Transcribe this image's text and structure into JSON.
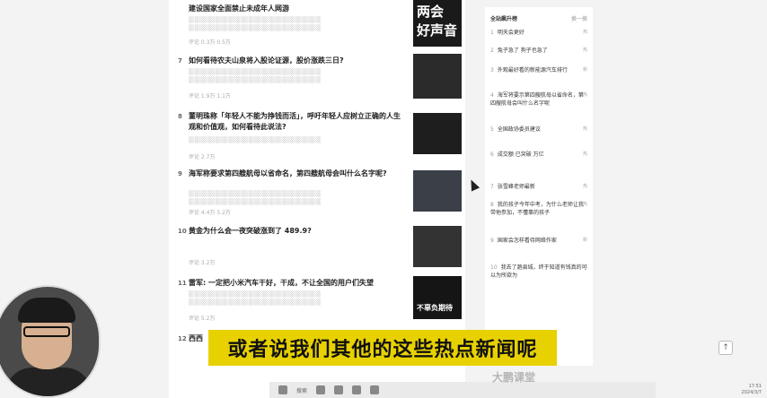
{
  "feed": {
    "items": [
      {
        "num": "",
        "title": "建设国家全面禁止未成年人网游",
        "meta": "评论 0.3万 0.5万"
      },
      {
        "num": "7",
        "title": "如何看待农夫山泉将入股论证源，股价涨跌三日?",
        "meta": "评论 1.9万 1.1万"
      },
      {
        "num": "8",
        "title": "董明珠称「年轻人不能为挣钱而活」，呼吁年轻人应树立正确的人生观和价值观，如何看待此说法?",
        "meta": "评论 2.7万"
      },
      {
        "num": "9",
        "title": "海军称要求第四艘航母以省命名，第四艘航母会叫什么名字呢?",
        "meta": "评论 4.4万 5.2万"
      },
      {
        "num": "10",
        "title": "黄金为什么会一夜突破涨到了 489.9?",
        "meta": "评论 3.2万"
      },
      {
        "num": "11",
        "title": "雷军: 一定把小米汽车干好，干成，不让全国的用户们失望",
        "meta": "评论 5.2万"
      },
      {
        "num": "12",
        "title": "西西",
        "meta": ""
      }
    ],
    "thumb1_text": "两会 好声音",
    "thumb6_text": "不辜负期待"
  },
  "sidebar": {
    "header": "全站飙升榜",
    "more": "换一换",
    "items": [
      {
        "num": "1",
        "text": "明天会更好",
        "tag": "热"
      },
      {
        "num": "2",
        "text": "兔子急了 狗子也急了",
        "tag": "热"
      },
      {
        "num": "3",
        "text": "外观最好看的新能源汽车排行",
        "tag": "新"
      },
      {
        "num": "4",
        "text": "海军将要示第四艘航母以省命名，第四艘航母会叫什么名字呢",
        "tag": "热"
      },
      {
        "num": "5",
        "text": "全国政协委员建议",
        "tag": "热"
      },
      {
        "num": "6",
        "text": "成交额 已突破 万亿",
        "tag": "热"
      },
      {
        "num": "7",
        "text": "张雪峰老师最新",
        "tag": "热"
      },
      {
        "num": "8",
        "text": "我的孩子今年中考，为什么老师让我带他参加，不懂事的孩子",
        "tag": "热"
      },
      {
        "num": "9",
        "text": "国家会怎样看待网络作家",
        "tag": "新"
      },
      {
        "num": "10",
        "text": "我去了趟县城，终于知道有钱真的可以为所欲为",
        "tag": "热"
      }
    ]
  },
  "subtitle": "或者说我们其他的这些热点新闻呢",
  "taskbar": {
    "search": "搜索"
  },
  "watermark": "大鹏课堂",
  "clock": {
    "time": "17:51",
    "date": "2024/3/7"
  }
}
